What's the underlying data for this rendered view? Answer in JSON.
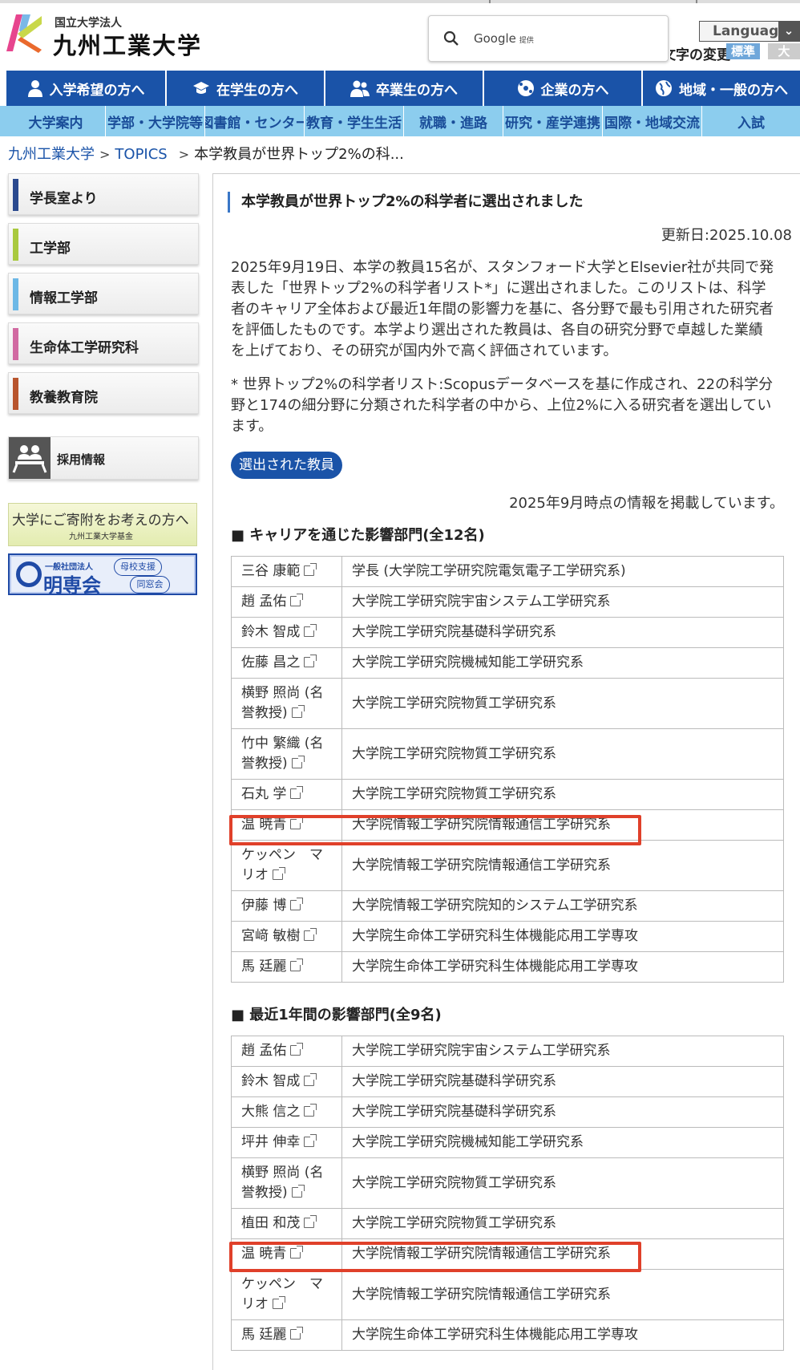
{
  "header": {
    "logo_small": "国立大学法人",
    "logo_big": "九州工業大学",
    "search_placeholder": "Google",
    "search_provider": "提供",
    "language_label": "Language",
    "font_size_label": "文字の変更",
    "font_std": "標準",
    "font_big": "大"
  },
  "nav_primary": [
    {
      "label": "入学希望の方へ",
      "icon": "person-icon"
    },
    {
      "label": "在学生の方へ",
      "icon": "mortarboard-icon"
    },
    {
      "label": "卒業生の方へ",
      "icon": "people-icon"
    },
    {
      "label": "企業の方へ",
      "icon": "globe-network-icon"
    },
    {
      "label": "地域・一般の方へ",
      "icon": "globe-icon"
    }
  ],
  "nav_secondary": [
    "大学案内",
    "学部・大学院等",
    "図書館・センター",
    "教育・学生生活",
    "就職・進路",
    "研究・産学連携",
    "国際・地域交流",
    "入試"
  ],
  "breadcrumb": {
    "home": "九州工業大学",
    "topics": "TOPICS",
    "current": "本学教員が世界トップ2%の科...",
    "sep": ">"
  },
  "sidebar": {
    "items": [
      {
        "label": "学長室より",
        "color": "#2b4a8f"
      },
      {
        "label": "工学部",
        "color": "#a9c93f"
      },
      {
        "label": "情報工学部",
        "color": "#6db8e6"
      },
      {
        "label": "生命体工学研究科",
        "color": "#d16aa2"
      },
      {
        "label": "教養教育院",
        "color": "#b8552e"
      }
    ],
    "recruit": "採用情報",
    "donate_title": "大学にご寄附をお考えの方へ",
    "donate_sub": "九州工業大学基金",
    "meisen_small": "一般社団法人",
    "meisen_name": "明専会",
    "meisen_c1": "母校支援",
    "meisen_c2": "同窓会"
  },
  "article": {
    "title": "本学教員が世界トップ2%の科学者に選出されました",
    "updated": "更新日:2025.10.08",
    "para1": "2025年9月19日、本学の教員15名が、スタンフォード大学とElsevier社が共同で発表した「世界トップ2%の科学者リスト*」に選出されました。このリストは、科学者のキャリア全体および最近1年間の影響力を基に、各分野で最も引用された研究者を評価したものです。本学より選出された教員は、各自の研究分野で卓越した業績を上げており、その研究が国内外で高く評価されています。",
    "para2": "* 世界トップ2%の科学者リスト:Scopusデータベースを基に作成され、22の科学分野と174の細分野に分類された科学者の中から、上位2%に入る研究者を選出しています。",
    "button": "選出された教員",
    "as_of": "2025年9月時点の情報を掲載しています。",
    "section1": "■ キャリアを通じた影響部門(全12名)",
    "section2": "■ 最近1年間の影響部門(全9名)",
    "table1": [
      [
        "三谷 康範",
        "学長 (大学院工学研究院電気電子工学研究系)"
      ],
      [
        "趙 孟佑",
        "大学院工学研究院宇宙システム工学研究系"
      ],
      [
        "鈴木 智成",
        "大学院工学研究院基礎科学研究系"
      ],
      [
        "佐藤 昌之",
        "大学院工学研究院機械知能工学研究系"
      ],
      [
        "横野 照尚 (名誉教授)",
        "大学院工学研究院物質工学研究系"
      ],
      [
        "竹中 繁織 (名誉教授)",
        "大学院工学研究院物質工学研究系"
      ],
      [
        "石丸 学",
        "大学院工学研究院物質工学研究系"
      ],
      [
        "温 暁青",
        "大学院情報工学研究院情報通信工学研究系"
      ],
      [
        "ケッペン　マリオ",
        "大学院情報工学研究院情報通信工学研究系"
      ],
      [
        "伊藤 博",
        "大学院情報工学研究院知的システム工学研究系"
      ],
      [
        "宮﨑 敏樹",
        "大学院生命体工学研究科生体機能応用工学専攻"
      ],
      [
        "馬 廷麗",
        "大学院生命体工学研究科生体機能応用工学専攻"
      ]
    ],
    "table2": [
      [
        "趙 孟佑",
        "大学院工学研究院宇宙システム工学研究系"
      ],
      [
        "鈴木 智成",
        "大学院工学研究院基礎科学研究系"
      ],
      [
        "大熊 信之",
        "大学院工学研究院基礎科学研究系"
      ],
      [
        "坪井 伸幸",
        "大学院工学研究院機械知能工学研究系"
      ],
      [
        "横野 照尚 (名誉教授)",
        "大学院工学研究院物質工学研究系"
      ],
      [
        "植田 和茂",
        "大学院工学研究院物質工学研究系"
      ],
      [
        "温 暁青",
        "大学院情報工学研究院情報通信工学研究系"
      ],
      [
        "ケッペン　マリオ",
        "大学院情報工学研究院情報通信工学研究系"
      ],
      [
        "馬 廷麗",
        "大学院生命体工学研究科生体機能応用工学専攻"
      ]
    ]
  },
  "colors": {
    "nav_blue": "#1a53a8",
    "nav_light": "#8ccdee",
    "highlight": "#e0402a"
  }
}
